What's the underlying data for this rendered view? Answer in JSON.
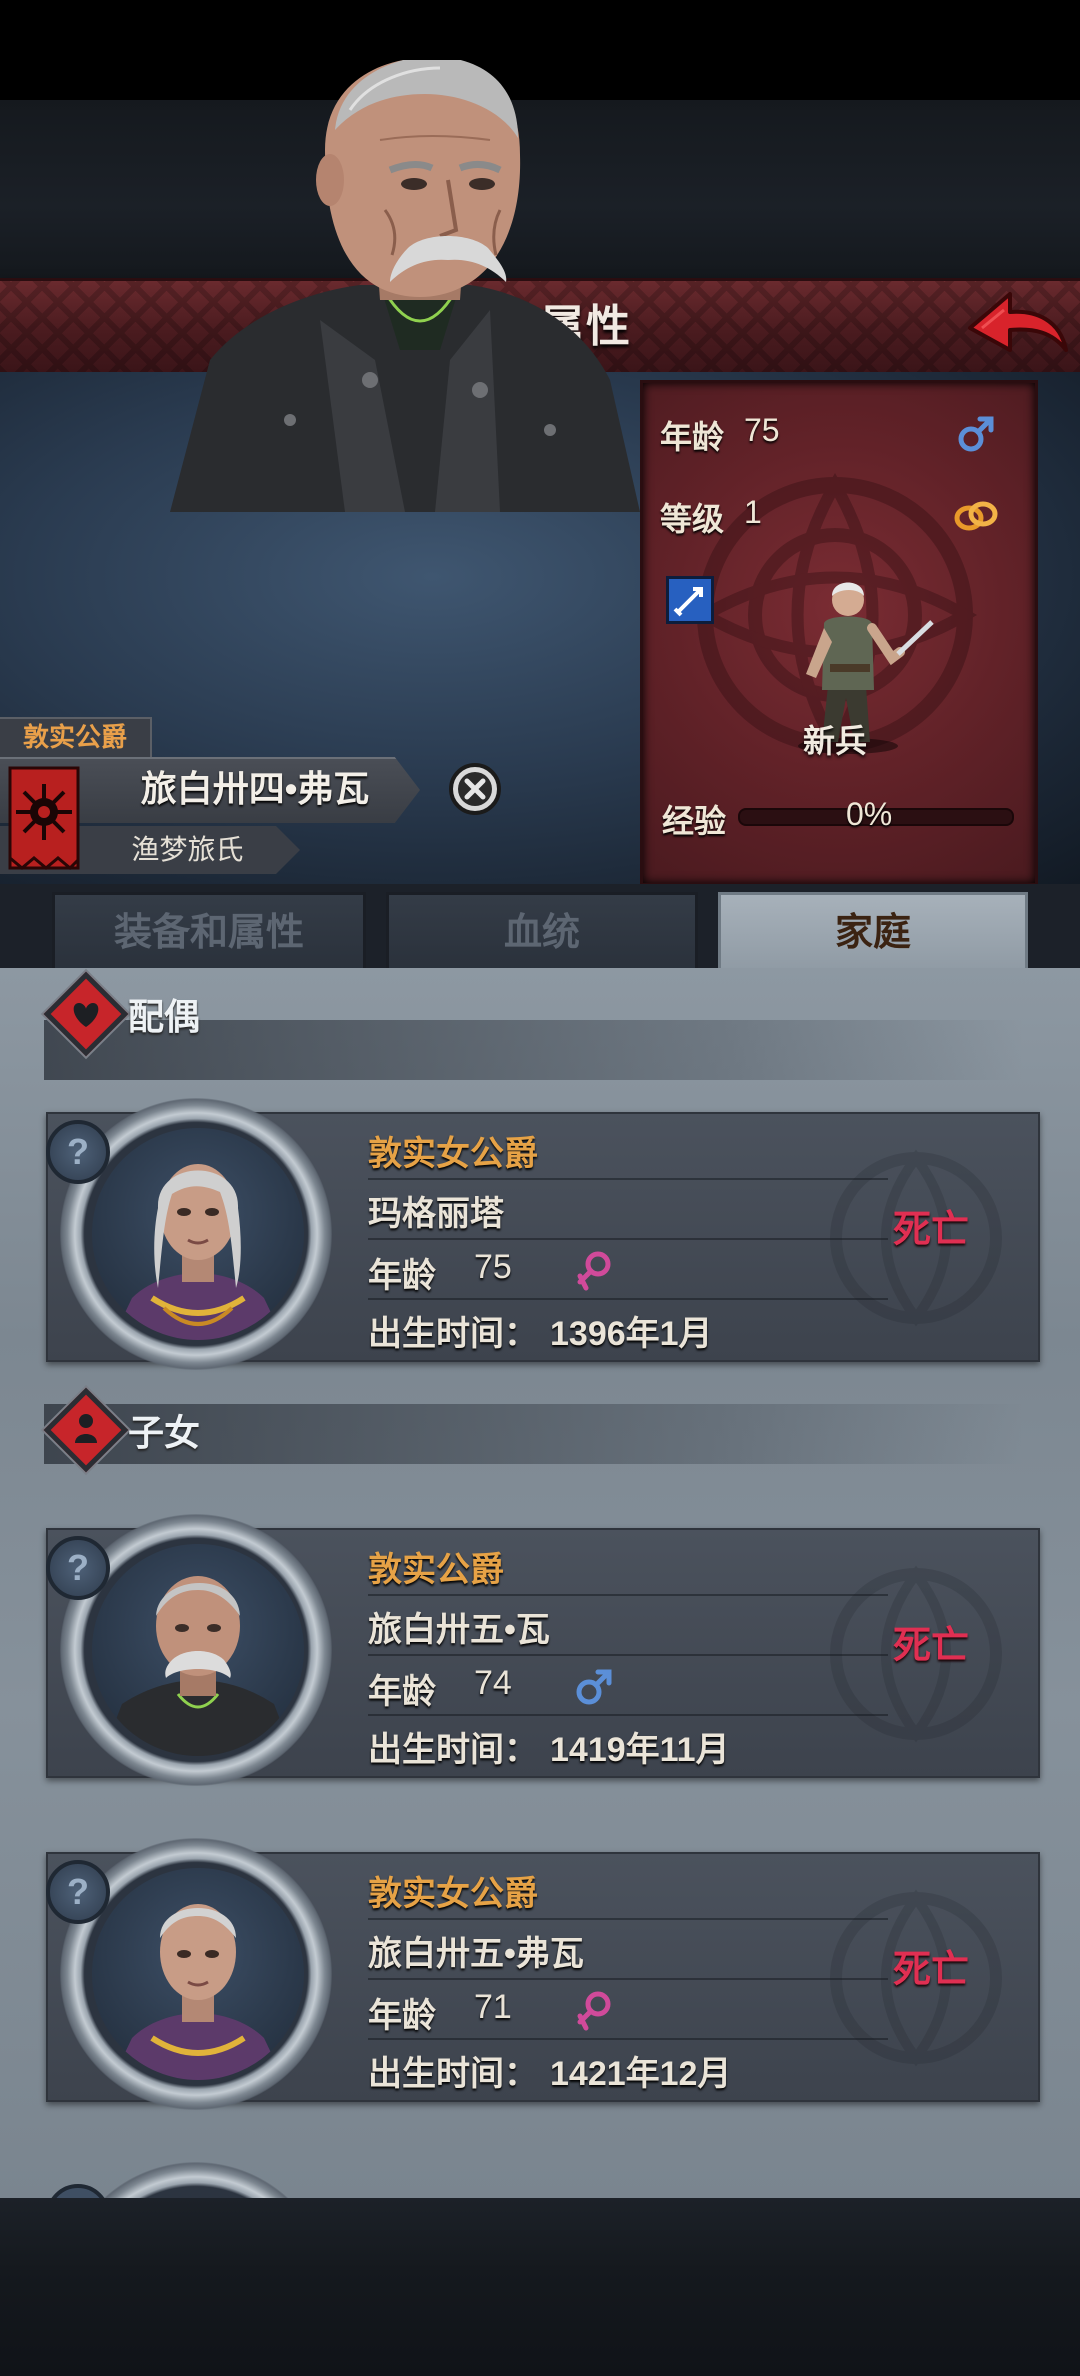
{
  "header": {
    "title": "角色属性"
  },
  "character": {
    "title": "敦实公爵",
    "name": "旅白卅四•弗瓦",
    "house": "渔梦旅氏"
  },
  "stats": {
    "age_label": "年龄",
    "age": "75",
    "level_label": "等级",
    "level": "1",
    "unit_type": "新兵",
    "exp_label": "经验",
    "exp_percent": "0%",
    "exp_fraction": 0
  },
  "tabs": [
    {
      "label": "装备和属性",
      "active": false
    },
    {
      "label": "血统",
      "active": false
    },
    {
      "label": "家庭",
      "active": true
    }
  ],
  "family": {
    "spouse_label": "配偶",
    "children_label": "子女",
    "age_label": "年龄",
    "birth_label": "出生时间：",
    "spouse": {
      "title": "敦实女公爵",
      "name": "玛格丽塔",
      "age": "75",
      "gender": "female",
      "birth": "1396年1月",
      "status": "死亡"
    },
    "children": [
      {
        "title": "敦实公爵",
        "name": "旅白卅五•瓦",
        "age": "74",
        "gender": "male",
        "birth": "1419年11月",
        "status": "死亡"
      },
      {
        "title": "敦实女公爵",
        "name": "旅白卅五•弗瓦",
        "age": "71",
        "gender": "female",
        "birth": "1421年12月",
        "status": "死亡"
      }
    ]
  },
  "colors": {
    "header": "#4a1b1f",
    "title_orange": "#e6a246",
    "dead_red": "#e02f52",
    "male_blue": "#5b8fd8",
    "female_pink": "#d04a9a"
  }
}
